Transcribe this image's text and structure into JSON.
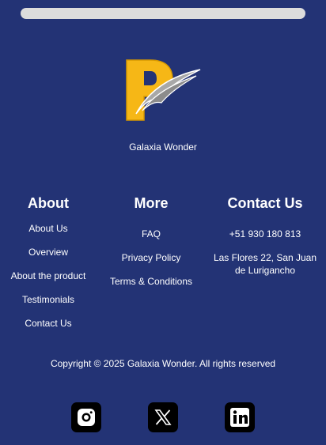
{
  "brand": {
    "name": "Galaxia Wonder"
  },
  "footer": {
    "about": {
      "heading": "About",
      "links": [
        "About Us",
        "Overview",
        "About the product",
        "Testimonials",
        "Contact Us"
      ]
    },
    "more": {
      "heading": "More",
      "links": [
        "FAQ",
        "Privacy Policy",
        "Terms & Conditions"
      ]
    },
    "contact": {
      "heading": "Contact Us",
      "phone": "+51 930 180 813",
      "address": "Las Flores 22, San Juan de Lurigancho"
    },
    "copyright": "Copyright © 2025 Galaxia Wonder. All rights reserved"
  },
  "social": [
    {
      "name": "instagram-icon"
    },
    {
      "name": "x-icon"
    },
    {
      "name": "linkedin-icon"
    }
  ],
  "colors": {
    "background": "#233375",
    "logo_yellow": "#F6B716",
    "logo_gray": "#9a9a9a",
    "icon_bg": "#000000"
  }
}
